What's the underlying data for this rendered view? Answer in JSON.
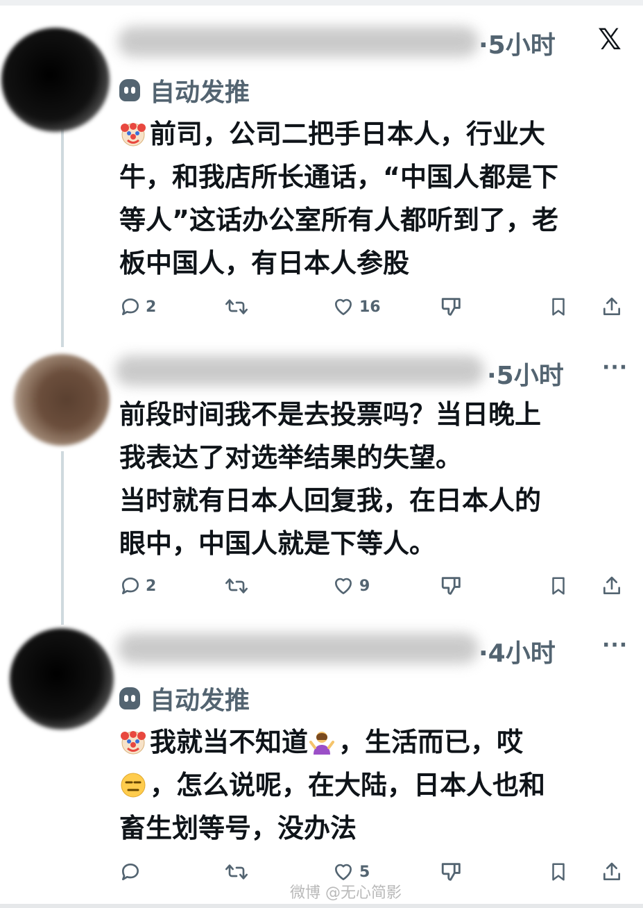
{
  "posts": [
    {
      "time": "·5小时",
      "auto_label": "自动发推",
      "lines": [
        "前司，公司二把手日本人，行业大",
        "牛，和我店所长通话，“中国人都是下",
        "等人”这话办公室所有人都听到了，老",
        "板中国人，有日本人参股"
      ],
      "stats": {
        "replies": "2",
        "reposts": "",
        "likes": "16"
      },
      "header_icon": "x-logo-icon"
    },
    {
      "time": "·5小时",
      "lines": [
        "前段时间我不是去投票吗？当日晚上",
        "我表达了对选举结果的失望。",
        "当时就有日本人回复我，在日本人的",
        "眼中，中国人就是下等人。"
      ],
      "stats": {
        "replies": "2",
        "reposts": "",
        "likes": "9"
      },
      "header_icon": "more-icon"
    },
    {
      "time": "·4小时",
      "auto_label": "自动发推",
      "lines": [
        "我就当不知道",
        "，生活而已，哎",
        "，怎么说呢，在大陆，日本人也和",
        "畜生划等号，没办法"
      ],
      "stats": {
        "replies": "",
        "reposts": "",
        "likes": "5"
      },
      "header_icon": "more-icon"
    }
  ],
  "header": {
    "x_logo": "𝕏",
    "more": "···"
  },
  "watermark": "微博 @无心简影",
  "colors": {
    "text": "#0f1419",
    "secondary": "#536471",
    "thread_line": "#cfd9de"
  }
}
